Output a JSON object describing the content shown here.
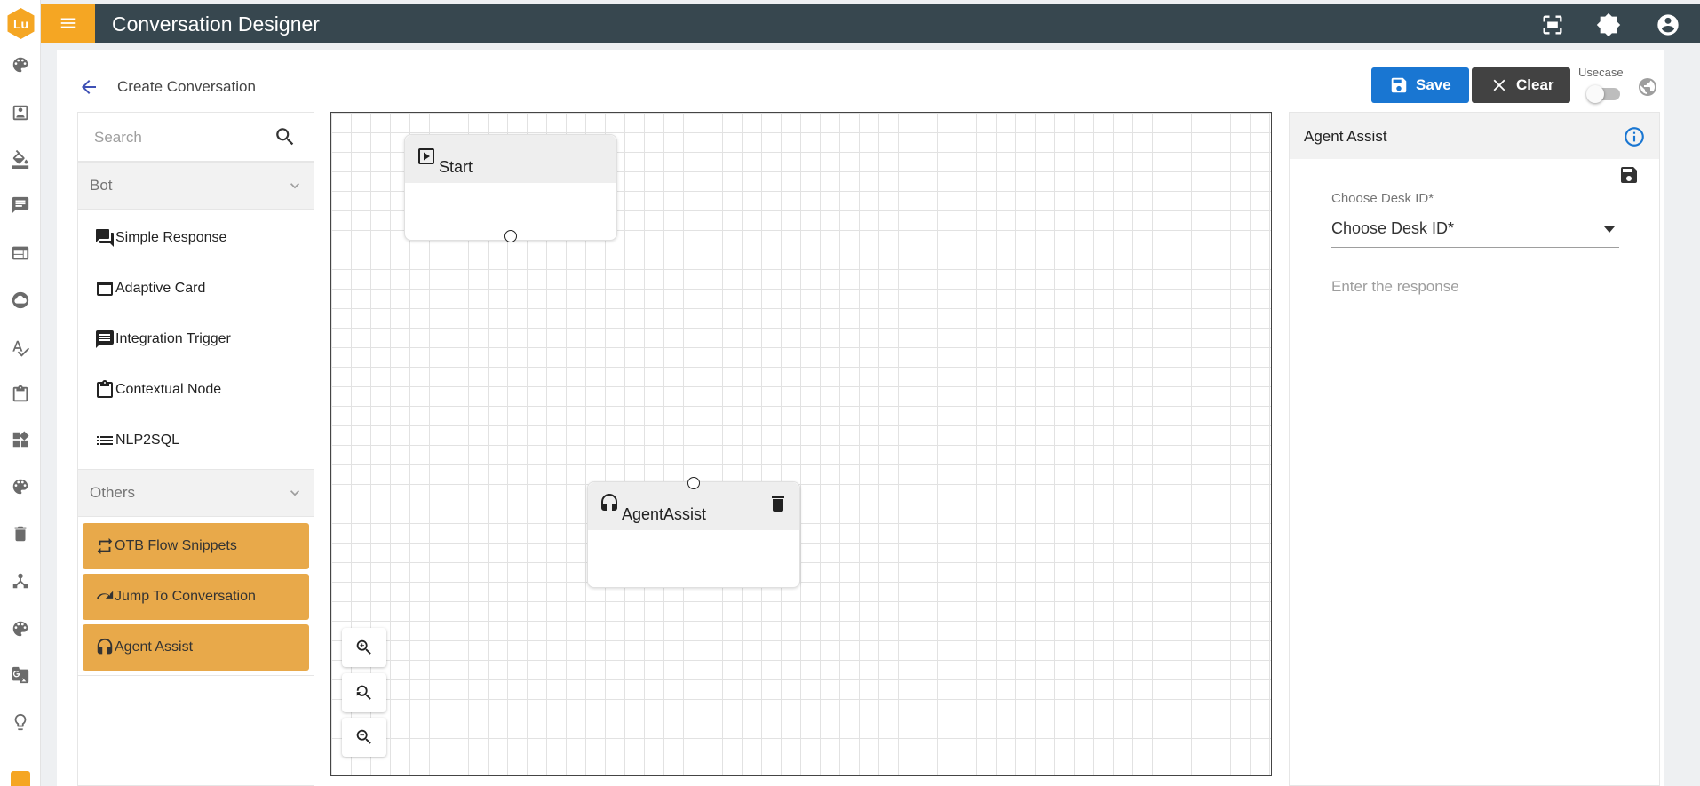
{
  "rail": {
    "logo_text": "Lu",
    "icons": [
      "palette-icon",
      "contact-icon",
      "format-paint-icon",
      "chat-icon",
      "web-icon",
      "cloud-icon",
      "spellcheck-icon",
      "clipboard-icon",
      "dashboard-icon",
      "palette-icon",
      "trash-icon",
      "hub-icon",
      "color-palette-icon",
      "translate-icon",
      "lightbulb-icon"
    ]
  },
  "header": {
    "title": "Conversation Designer",
    "icons": [
      "fullscreen-icon",
      "settings-icon",
      "account-icon"
    ]
  },
  "page": {
    "title": "Create Conversation",
    "save_label": "Save",
    "clear_label": "Clear",
    "usecase_label": "Usecase"
  },
  "palette": {
    "search_placeholder": "Search",
    "bot_section": "Bot",
    "bot_items": [
      "Simple Response",
      "Adaptive Card",
      "Integration Trigger",
      "Contextual Node",
      "NLP2SQL"
    ],
    "others_section": "Others",
    "others_items": [
      "OTB Flow Snippets",
      "Jump To Conversation",
      "Agent Assist"
    ]
  },
  "canvas": {
    "nodes": [
      {
        "title": "Start",
        "icon": "play-box-icon"
      },
      {
        "title": "AgentAssist",
        "icon": "headset-icon"
      }
    ]
  },
  "properties": {
    "title": "Agent Assist",
    "desk_label": "Choose Desk ID*",
    "desk_value": "Choose Desk ID*",
    "response_placeholder": "Enter the response"
  },
  "colors": {
    "header_bg": "#37474f",
    "menu_accent": "#f5a623",
    "save_button": "#1976d2",
    "clear_button": "#424242",
    "others_item_bg": "#e8a94a"
  }
}
